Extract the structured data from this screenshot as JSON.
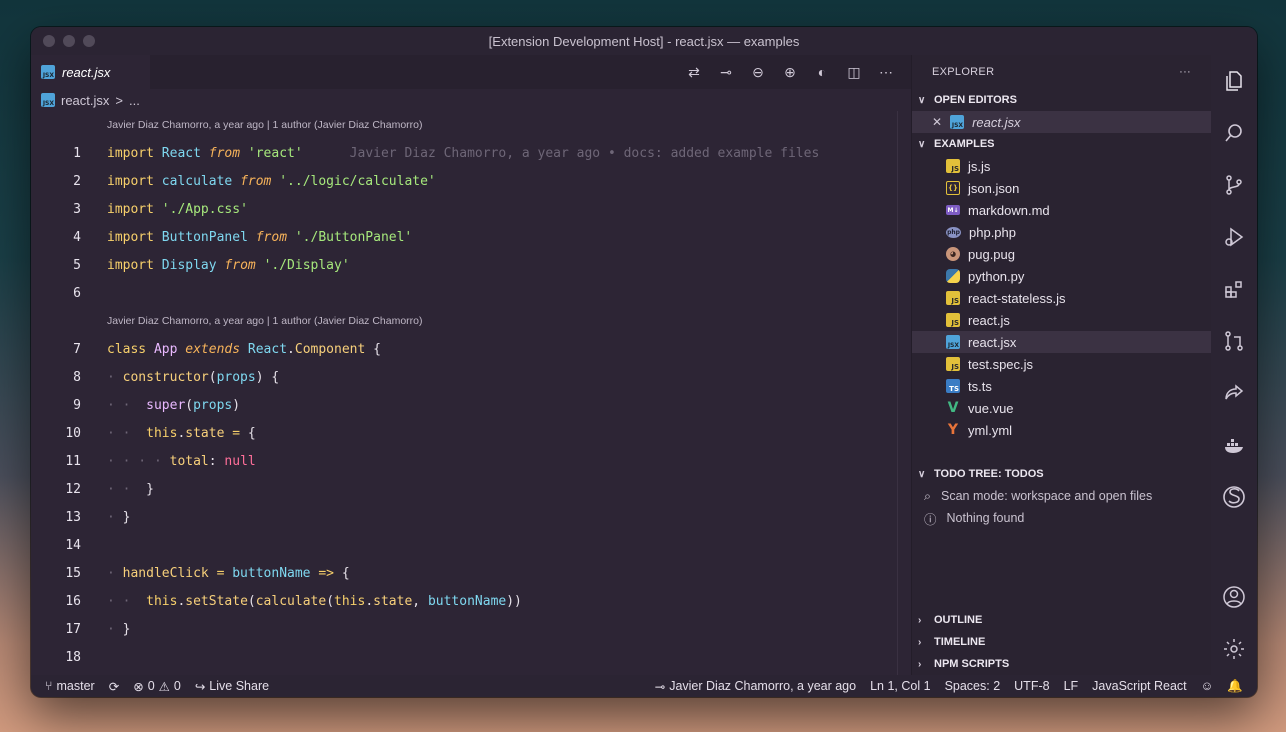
{
  "window": {
    "title": "[Extension Development Host] - react.jsx — examples"
  },
  "tab": {
    "label": "react.jsx",
    "icon": "jsx-file-icon"
  },
  "breadcrumb": {
    "file": "react.jsx",
    "sep": ">",
    "more": "..."
  },
  "codelens": {
    "first": "Javier Diaz Chamorro, a year ago | 1 author (Javier Diaz Chamorro)",
    "second": "Javier Diaz Chamorro, a year ago | 1 author (Javier Diaz Chamorro)"
  },
  "code": {
    "blame_line1": "Javier Diaz Chamorro, a year ago • docs: added example files",
    "lines": [
      {
        "n": "1"
      },
      {
        "n": "2"
      },
      {
        "n": "3"
      },
      {
        "n": "4"
      },
      {
        "n": "5"
      },
      {
        "n": "6"
      },
      {
        "n": "7"
      },
      {
        "n": "8"
      },
      {
        "n": "9"
      },
      {
        "n": "10"
      },
      {
        "n": "11"
      },
      {
        "n": "12"
      },
      {
        "n": "13"
      },
      {
        "n": "14"
      },
      {
        "n": "15"
      },
      {
        "n": "16"
      },
      {
        "n": "17"
      },
      {
        "n": "18"
      }
    ]
  },
  "explorer": {
    "title": "EXPLORER",
    "more": "···",
    "open_editors": {
      "label": "OPEN EDITORS",
      "items": [
        {
          "name": "react.jsx",
          "icon": "jsx"
        }
      ]
    },
    "examples": {
      "label": "EXAMPLES",
      "files": [
        {
          "name": "js.js",
          "icon": "JS"
        },
        {
          "name": "json.json",
          "icon": "{}"
        },
        {
          "name": "markdown.md",
          "icon": "M↓"
        },
        {
          "name": "php.php",
          "icon": "php"
        },
        {
          "name": "pug.pug",
          "icon": "🐶"
        },
        {
          "name": "python.py",
          "icon": ""
        },
        {
          "name": "react-stateless.js",
          "icon": "JS"
        },
        {
          "name": "react.js",
          "icon": "JS"
        },
        {
          "name": "react.jsx",
          "icon": "jsx"
        },
        {
          "name": "test.spec.js",
          "icon": "JS"
        },
        {
          "name": "ts.ts",
          "icon": "TS"
        },
        {
          "name": "vue.vue",
          "icon": "V"
        },
        {
          "name": "yml.yml",
          "icon": "Y"
        }
      ]
    },
    "todo": {
      "label": "TODO TREE: TODOS",
      "scan": "Scan mode: workspace and open files",
      "nothing": "Nothing found"
    },
    "outline": "OUTLINE",
    "timeline": "TIMELINE",
    "npm": "NPM SCRIPTS"
  },
  "status": {
    "branch": "master",
    "errors": "0",
    "warnings": "0",
    "live_share": "Live Share",
    "blame": "Javier Diaz Chamorro, a year ago",
    "position": "Ln 1, Col 1",
    "spaces": "Spaces: 2",
    "encoding": "UTF-8",
    "eol": "LF",
    "language": "JavaScript React"
  },
  "colors": {
    "background": "#2d2535",
    "sidebar": "#2a2331",
    "selected": "#3b3243"
  }
}
